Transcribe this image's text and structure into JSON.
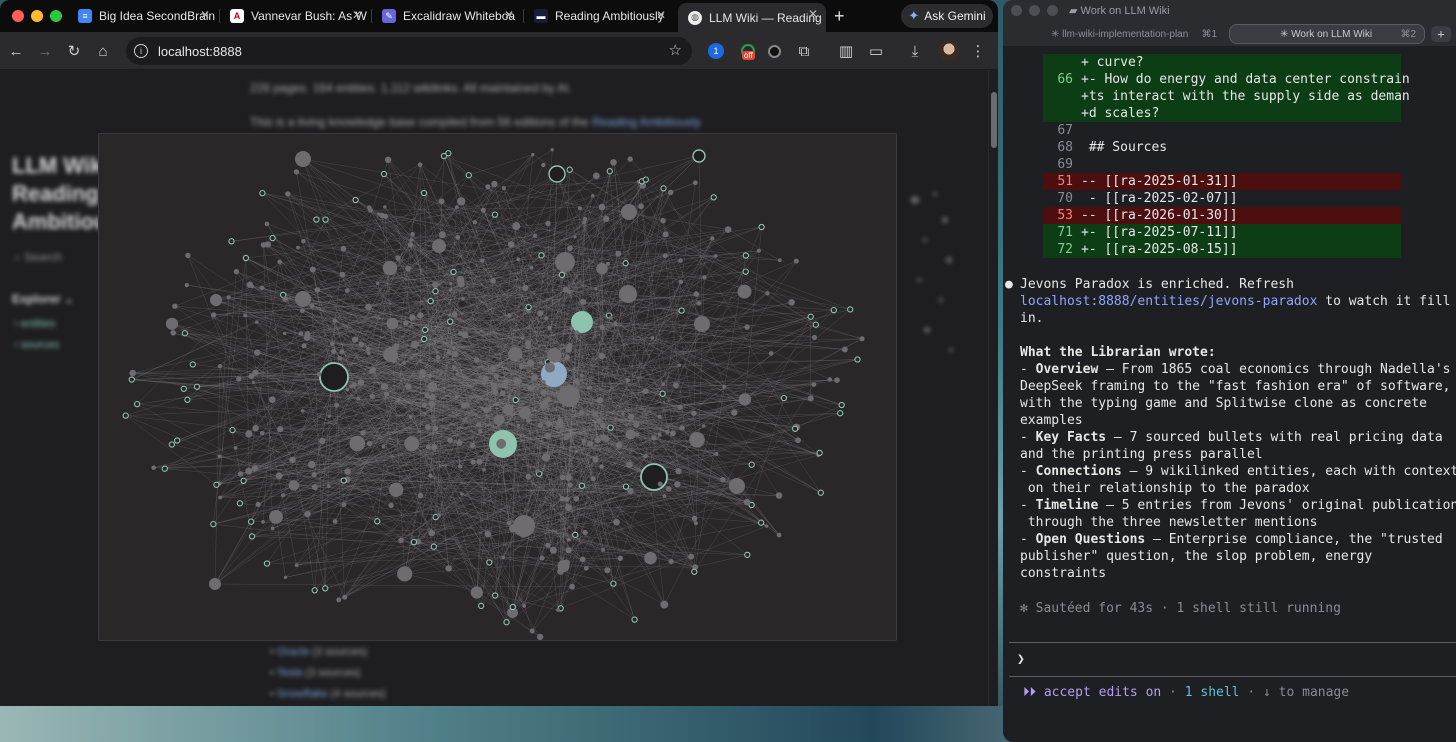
{
  "browser": {
    "tabs": [
      {
        "title": "Big Idea SecondBrain",
        "favicon": "google-docs-icon",
        "active": false
      },
      {
        "title": "Vannevar Bush: As W",
        "favicon": "atlantic-icon",
        "active": false
      },
      {
        "title": "Excalidraw Whiteboa",
        "favicon": "excalidraw-icon",
        "active": false
      },
      {
        "title": "Reading Ambitiously",
        "favicon": "reading-ambitiously-icon",
        "active": false
      },
      {
        "title": "LLM Wiki — Reading",
        "favicon": "globe-icon",
        "active": true
      }
    ],
    "gemini_label": "Ask Gemini",
    "url": "localhost:8888",
    "extension_badge": "off"
  },
  "page": {
    "meta_line": "226 pages. 164 entities. 1,112 wikilinks. All maintained by AI.",
    "intro_text": "This is a living knowledge base compiled from 56 editions of the ",
    "intro_link": "Reading Ambitiously",
    "site_title": "LLM Wiki Reading Ambitiously",
    "search_placeholder": "Search",
    "explorer_label": "Explorer",
    "tree": [
      "entities",
      "sources"
    ],
    "bottom_list": [
      {
        "name": "Oracle",
        "count": "(3 sources)"
      },
      {
        "name": "Tesla",
        "count": "(3 sources)"
      },
      {
        "name": "Snowflake",
        "count": "(4 sources)"
      }
    ]
  },
  "colors": {
    "graph_node": "#6f6c6f",
    "graph_tag": "#8ec3b0",
    "graph_highlight": "#8fa8c4",
    "graph_edge": "#8a878a",
    "diff_add": "#0c3d15",
    "diff_del": "#4d0e0f"
  },
  "terminal": {
    "window_title": "Work on LLM Wiki",
    "tabs": [
      {
        "label": "✳ llm-wiki-implementation-plan",
        "kbd": "⌘1"
      },
      {
        "label": "✳ Work on LLM Wiki",
        "kbd": "⌘2"
      }
    ],
    "plus": "+",
    "diff": [
      {
        "kind": "add",
        "num": "",
        "text": "+ curve?"
      },
      {
        "kind": "add",
        "num": "66",
        "text": "+- How do energy and data center constrain"
      },
      {
        "kind": "add",
        "num": "",
        "text": "+ts interact with the supply side as deman"
      },
      {
        "kind": "add",
        "num": "",
        "text": "+d scales?"
      },
      {
        "kind": "ctx",
        "num": "67",
        "text": ""
      },
      {
        "kind": "ctx",
        "num": "68",
        "text": " ## Sources"
      },
      {
        "kind": "ctx",
        "num": "69",
        "text": ""
      },
      {
        "kind": "del",
        "num": "51",
        "text": "-- [[ra-2025-01-31]]"
      },
      {
        "kind": "ctx",
        "num": "70",
        "text": " - [[ra-2025-02-07]]"
      },
      {
        "kind": "del",
        "num": "53",
        "text": "-- [[ra-2026-01-30]]"
      },
      {
        "kind": "add",
        "num": "71",
        "text": "+- [[ra-2025-07-11]]"
      },
      {
        "kind": "add",
        "num": "72",
        "text": "+- [[ra-2025-08-15]]"
      }
    ],
    "bullet": "●",
    "message": {
      "line1": "Jevons Paradox is enriched. Refresh",
      "link": "localhost:8888/entities/jevons-paradox",
      "line2_suffix": " to watch it fill",
      "line3": "in.",
      "heading": "What the Librarian wrote:",
      "items": [
        {
          "label": "Overview",
          "lines": [
            " — From 1865 coal economics through Nadella's",
            "DeepSeek framing to the \"fast fashion era\" of software,",
            "with the typing game and Splitwise clone as concrete",
            "examples"
          ]
        },
        {
          "label": "Key Facts",
          "lines": [
            " — 7 sourced bullets with real pricing data",
            "and the printing press parallel"
          ]
        },
        {
          "label": "Connections",
          "lines": [
            " — 9 wikilinked entities, each with context",
            " on their relationship to the paradox"
          ]
        },
        {
          "label": "Timeline",
          "lines": [
            " — 5 entries from Jevons' original publication",
            " through the three newsletter mentions"
          ]
        },
        {
          "label": "Open Questions",
          "lines": [
            " — Enterprise compliance, the \"trusted",
            "publisher\" question, the slop problem, energy",
            "constraints"
          ]
        }
      ]
    },
    "status": "✻ Sautéed for 43s · 1 shell still running",
    "prompt": "❯",
    "footer": {
      "arrows": "⏵⏵",
      "accept": " accept edits on",
      "sep": " · ",
      "shell": "1 shell",
      "manage": " · ↓ to manage"
    }
  }
}
